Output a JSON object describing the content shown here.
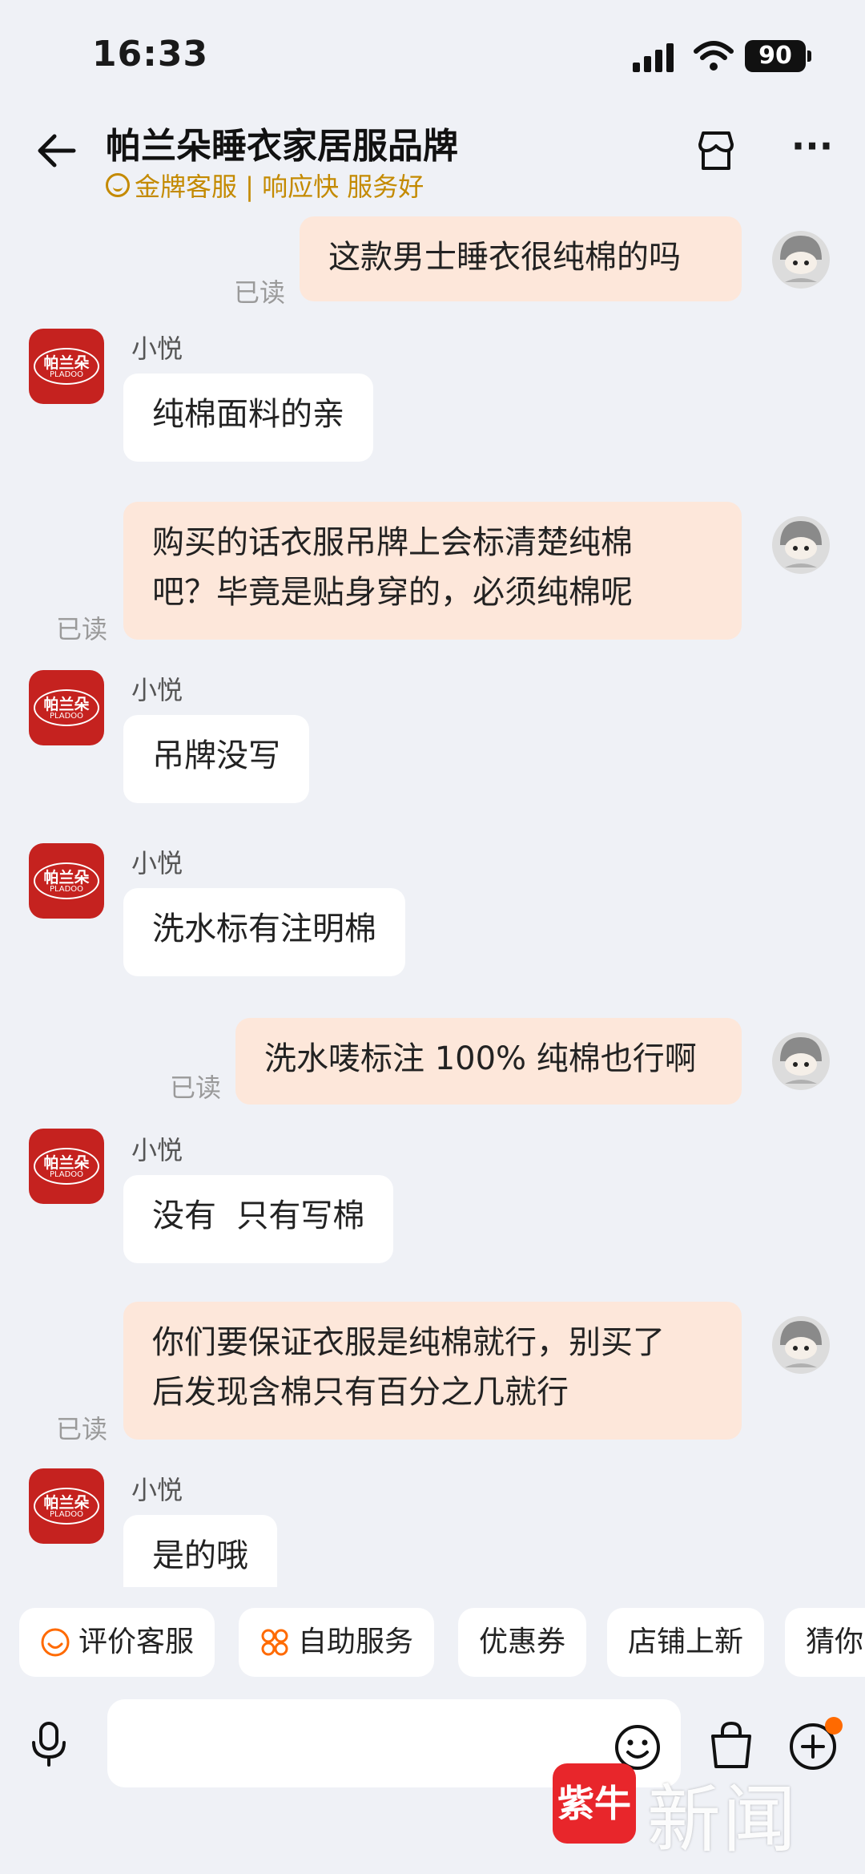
{
  "status_bar": {
    "time": "16:33",
    "battery": "90"
  },
  "header": {
    "shop_name": "帕兰朵睡衣家居服品牌",
    "subtitle": "金牌客服 | 响应快 服务好"
  },
  "shop_avatar": {
    "logo_text": "帕兰朵",
    "logo_sub": "PLADOO"
  },
  "messages": [
    {
      "from": "me",
      "text": "这款男士睡衣很纯棉的吗",
      "status": "已读"
    },
    {
      "from": "shop",
      "sender": "小悦",
      "text": "纯棉面料的亲"
    },
    {
      "from": "me",
      "lines": [
        "购买的话衣服吊牌上会标清楚纯棉",
        "吧？毕竟是贴身穿的，必须纯棉呢"
      ],
      "status": "已读"
    },
    {
      "from": "shop",
      "sender": "小悦",
      "text": "吊牌没写"
    },
    {
      "from": "shop",
      "sender": "小悦",
      "text": "洗水标有注明棉"
    },
    {
      "from": "me",
      "text": "洗水唛标注 100% 纯棉也行啊",
      "status": "已读"
    },
    {
      "from": "shop",
      "sender": "小悦",
      "text": "没有  只有写棉"
    },
    {
      "from": "me",
      "lines": [
        "你们要保证衣服是纯棉就行，别买了",
        "后发现含棉只有百分之几就行"
      ],
      "status": "已读"
    },
    {
      "from": "shop",
      "sender": "小悦",
      "text": "是的哦"
    }
  ],
  "quick_actions": [
    "评价客服",
    "自助服务",
    "优惠券",
    "店铺上新",
    "猜你"
  ],
  "input": {
    "placeholder": ""
  },
  "watermark": {
    "badge": "紫牛",
    "text": "新闻"
  },
  "colors": {
    "my_bubble": "#fde7da",
    "shop_bubble": "#ffffff",
    "gold": "#c48a00",
    "brand_red": "#c5221f"
  }
}
